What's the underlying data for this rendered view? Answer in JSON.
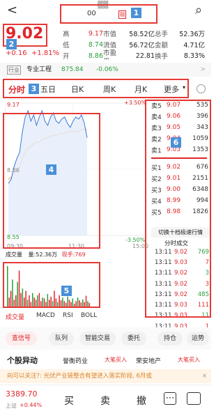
{
  "header": {
    "back": "<",
    "code": "00",
    "code_masked": "▓▓",
    "badge": "融",
    "search": "⌕"
  },
  "quote": {
    "price": "9.02",
    "change": "+0.16",
    "change_pct": "+1.81%"
  },
  "stats": [
    [
      "高",
      "9.17",
      "市值",
      "58.52亿",
      "总手",
      "52.36万"
    ],
    [
      "低",
      "8.74",
      "流值",
      "56.72亿",
      "金额",
      "4.71亿"
    ],
    [
      "开",
      "8.86",
      "市盈™",
      "22.81",
      "换手",
      "8.33%"
    ]
  ],
  "industry": {
    "tag": "行业",
    "name": "专业工程",
    "value": "875.84",
    "change": "-0.06%",
    "arrow": ">"
  },
  "tabs": [
    "分时",
    "五日",
    "日K",
    "周K",
    "月K",
    "更多"
  ],
  "chart": {
    "high": "9.17",
    "high_pct": "+3.50%",
    "low": "8.55",
    "low_pct": "-3.50%",
    "mid_label": "8.86",
    "time_start": "09:30",
    "time_mid": "11:30",
    "time_end": "15:00"
  },
  "volume": {
    "label": "成交量",
    "vol": "量:52.36万",
    "hand": "现手:769"
  },
  "ind_tabs": [
    "成交量",
    "MACD",
    "RSI",
    "BOLL"
  ],
  "sell": [
    [
      "卖5",
      "9.07",
      "535"
    ],
    [
      "卖4",
      "9.06",
      "396"
    ],
    [
      "卖3",
      "9.05",
      "343"
    ],
    [
      "卖2",
      "9.04",
      "1059"
    ],
    [
      "卖1",
      "9.03",
      "1353"
    ]
  ],
  "buy": [
    [
      "买1",
      "9.02",
      "676"
    ],
    [
      "买2",
      "9.01",
      "2151"
    ],
    [
      "买3",
      "9.00",
      "6348"
    ],
    [
      "买4",
      "8.99",
      "994"
    ],
    [
      "买5",
      "8.98",
      "1826"
    ]
  ],
  "switch_label": "切换十档极速行情",
  "tick_title": "分时成交",
  "ticks": [
    [
      "13:11",
      "9.02",
      "769"
    ],
    [
      "13:11",
      "9.03",
      "7"
    ],
    [
      "13:11",
      "9.02",
      "3"
    ],
    [
      "13:11",
      "9.02",
      "3"
    ],
    [
      "13:11",
      "9.02",
      "485"
    ],
    [
      "13:11",
      "9.03",
      "111"
    ],
    [
      "13:11",
      "9.03",
      "11"
    ],
    [
      "13:11",
      "9.03",
      "1"
    ]
  ],
  "actions": [
    "查信号",
    "队列",
    "智能交易",
    "委托",
    "持仓",
    "运势"
  ],
  "news": {
    "title": "个股异动",
    "tag1": "誉衡药业",
    "act1": "大笔买入",
    "tag2": "荣安地产",
    "act2": "大笔买入"
  },
  "tip": {
    "text": "向可以关注?: 光伏产业链整合有望进入落实阶段, 6月或",
    "close": "×"
  },
  "bottom": {
    "index_value": "3389.70",
    "index_name": "上证",
    "index_pct": "+0.44%",
    "buy": "买",
    "sell": "卖",
    "cancel": "撤",
    "more": "⋯"
  },
  "annotations": [
    "1",
    "2",
    "3",
    "4",
    "5",
    "6"
  ],
  "colors": {
    "up": "#e0262b",
    "down": "#2a9d3a",
    "accent": "#e0262b",
    "anno": "#e53935",
    "tagbg": "#4a90d9"
  },
  "chart_data": {
    "type": "line",
    "price": [
      8.8,
      8.82,
      8.88,
      8.92,
      8.95,
      9.05,
      9.12,
      9.15,
      9.1,
      9.13,
      9.08,
      9.12,
      9.15,
      9.1,
      9.08,
      9.12,
      9.14,
      9.1,
      9.09,
      9.11,
      9.12,
      9.09,
      9.07,
      9.1,
      9.12,
      9.11,
      9.13,
      9.09,
      9.02
    ],
    "avg": [
      8.82,
      8.83,
      8.85,
      8.86,
      8.88,
      8.92,
      8.95,
      8.97,
      8.98,
      8.99,
      9.0,
      9.0,
      9.01,
      9.02,
      9.02,
      9.03,
      9.03,
      9.03,
      9.04,
      9.04,
      9.04,
      9.05,
      9.05,
      9.05,
      9.05,
      9.05,
      9.06,
      9.06,
      9.06
    ],
    "volume": [
      90,
      20,
      35,
      60,
      15,
      25,
      55,
      80,
      30,
      40,
      20,
      35,
      15,
      25,
      10,
      30,
      20,
      15,
      25,
      30,
      12,
      20,
      18,
      10,
      28,
      15,
      22,
      12,
      35,
      18,
      10,
      25,
      14,
      20,
      12,
      8,
      22,
      15,
      10,
      18,
      6,
      12,
      20,
      14,
      9,
      16,
      10,
      24,
      12,
      8
    ],
    "ylim": [
      8.55,
      9.17
    ]
  }
}
